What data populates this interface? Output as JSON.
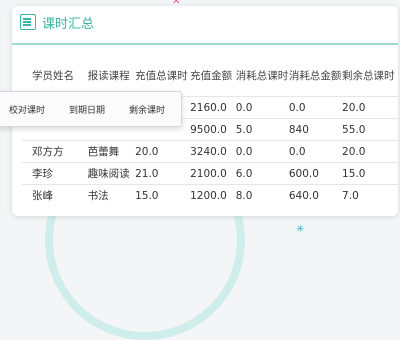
{
  "title": "课时汇总",
  "columns": [
    "学员姓名",
    "报读课程",
    "充值总课时",
    "充值金额",
    "消耗总课时",
    "消耗总金额",
    "剩余总课时"
  ],
  "rows": [
    [
      "",
      "",
      "",
      "2160.0",
      "0.0",
      "0.0",
      "20.0"
    ],
    [
      "",
      "",
      "",
      "9500.0",
      "5.0",
      "840",
      "55.0"
    ],
    [
      "邓方方",
      "芭蕾舞",
      "20.0",
      "3240.0",
      "0.0",
      "0.0",
      "20.0"
    ],
    [
      "李珍",
      "趣味阅读",
      "21.0",
      "2100.0",
      "6.0",
      "600.0",
      "15.0"
    ],
    [
      "张峰",
      "书法",
      "15.0",
      "1200.0",
      "8.0",
      "640.0",
      "7.0"
    ]
  ],
  "popup": {
    "col1": "校对课时",
    "col2": "到期日期",
    "col3": "剩余课时"
  },
  "colors": {
    "accent": "#38b6a4",
    "background": "#f3f5f6",
    "card": "#ffffff"
  }
}
